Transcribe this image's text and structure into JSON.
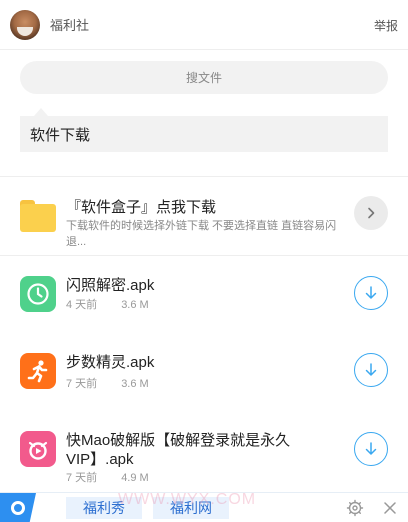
{
  "header": {
    "title": "福利社",
    "report_label": "举报"
  },
  "search": {
    "placeholder": "搜文件"
  },
  "notice": {
    "text": "软件下载"
  },
  "folder": {
    "title": "『软件盒子』点我下载",
    "description": "下载软件的时候选择外链下载 不要选择直链 直链容易闪退...",
    "icon": "folder-icon"
  },
  "files": [
    {
      "name": "闪照解密.apk",
      "age": "4 天前",
      "size": "3.6 M",
      "icon": "clock-icon",
      "color": "#4fd18b"
    },
    {
      "name": "步数精灵.apk",
      "age": "7 天前",
      "size": "3.6 M",
      "icon": "runner-icon",
      "color": "#ff7019"
    },
    {
      "name": "快Mao破解版【破解登录就是永久VIP】.apk",
      "age": "7 天前",
      "size": "4.9 M",
      "icon": "cat-icon",
      "color": "#f25a8c"
    }
  ],
  "bottom_bar": {
    "nav": [
      "福利秀",
      "福利网"
    ],
    "watermark": "WWW.WYX.COM"
  },
  "colors": {
    "accent": "#2d8ff0",
    "download": "#3aa8f0"
  }
}
